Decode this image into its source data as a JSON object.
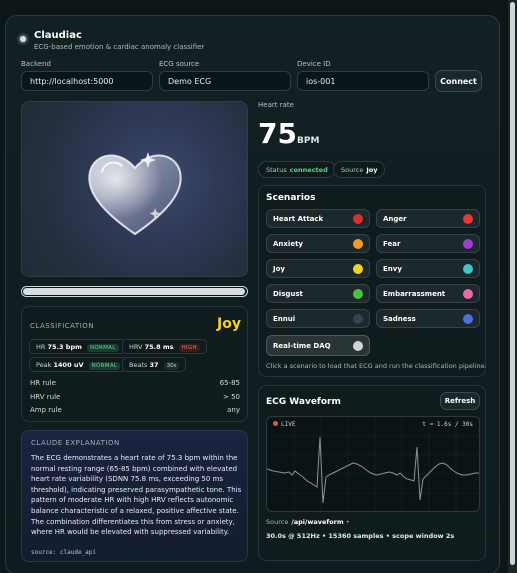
{
  "app": {
    "title": "Claudiac",
    "subtitle": "ECG-based emotion & cardiac anomaly classifier"
  },
  "connection": {
    "backend_label": "Backend",
    "backend_value": "http://localhost:5000",
    "source_label": "ECG source",
    "source_value": "Demo ECG",
    "device_label": "Device ID",
    "device_value": "ios-001",
    "connect_label": "Connect"
  },
  "progress": {
    "fraction": 0.995
  },
  "classification": {
    "label": "CLASSIFICATION",
    "emotion": "Joy",
    "emotion_color": "#f5d221",
    "hr_label": "HR",
    "hr_value": "75.3 bpm",
    "hr_tag": "NORMAL",
    "hrv_label": "HRV",
    "hrv_value": "75.8 ms",
    "hrv_tag": "HIGH",
    "peak_label": "Peak",
    "peak_value": "1400 uV",
    "peak_tag": "NORMAL",
    "beats_label": "Beats",
    "beats_value": "37",
    "beats_unit": "30s",
    "rules": [
      {
        "label": "HR rule",
        "value": "65-85"
      },
      {
        "label": "HRV rule",
        "value": "> 50"
      },
      {
        "label": "Amp rule",
        "value": "any"
      }
    ]
  },
  "explanation": {
    "label": "CLAUDE EXPLANATION",
    "text": "The ECG demonstrates a heart rate of 75.3 bpm within the normal resting range (65-85 bpm) combined with elevated heart rate variability (SDNN 75.8 ms, exceeding 50 ms threshold), indicating preserved parasympathetic tone. This pattern of moderate HR with high HRV reflects autonomic balance characteristic of a relaxed, positive affective state. The combination differentiates this from stress or anxiety, where HR would be elevated with suppressed variability.",
    "source": "source: claude_api"
  },
  "heart_rate": {
    "label": "Heart rate",
    "value": "75",
    "unit": "BPM",
    "status_label": "Status",
    "status_value": "connected",
    "source_label": "Source",
    "source_value": "Joy"
  },
  "scenarios": {
    "title": "Scenarios",
    "items": [
      {
        "label": "Heart Attack",
        "color": "#d93030"
      },
      {
        "label": "Anger",
        "color": "#e53935"
      },
      {
        "label": "Anxiety",
        "color": "#f59a23"
      },
      {
        "label": "Fear",
        "color": "#9c3fd1"
      },
      {
        "label": "Joy",
        "color": "#f5d221"
      },
      {
        "label": "Envy",
        "color": "#3fc4c9"
      },
      {
        "label": "Disgust",
        "color": "#4cc33f"
      },
      {
        "label": "Embarrassment",
        "color": "#e86aa6"
      },
      {
        "label": "Ennui",
        "color": "#3a3f5c"
      },
      {
        "label": "Sadness",
        "color": "#4f6ee0"
      }
    ],
    "realtime_label": "Real-time DAQ",
    "hint": "Click a scenario to load that ECG and run the classification pipeline."
  },
  "waveform": {
    "title": "ECG Waveform",
    "refresh_label": "Refresh",
    "live_label": "LIVE",
    "time_scale": "t = 1.6s / 30s",
    "source_label": "Source",
    "source_value": "/api/waveform",
    "meta": "30.0s @ 512Hz • 15360 samples • scope window 2s"
  },
  "icons": {
    "app_dot": "status-dot-icon",
    "heart": "glass-heart-icon",
    "record": "record-dot-icon"
  }
}
